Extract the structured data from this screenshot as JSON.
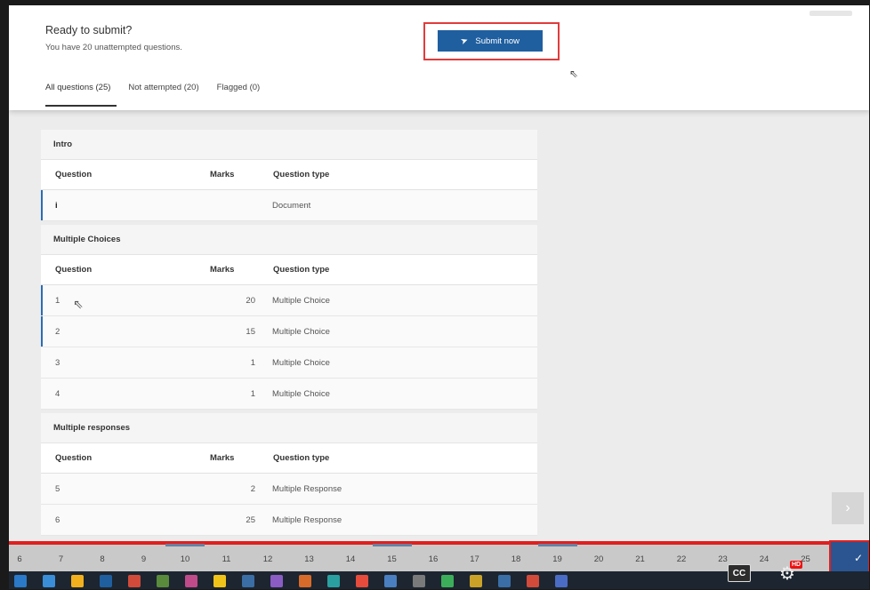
{
  "header": {
    "title": "Ready to submit?",
    "subtitle": "You have 20 unattempted questions.",
    "submit_label": "Submit now"
  },
  "tabs": [
    {
      "label": "All questions (25)",
      "active": true
    },
    {
      "label": "Not attempted (20)",
      "active": false
    },
    {
      "label": "Flagged (0)",
      "active": false
    }
  ],
  "columns": {
    "question": "Question",
    "marks": "Marks",
    "type": "Question type"
  },
  "sections": [
    {
      "name": "Intro",
      "rows": [
        {
          "question": "i",
          "marks": "",
          "type": "Document",
          "attempted": true
        }
      ]
    },
    {
      "name": "Multiple Choices",
      "rows": [
        {
          "question": "1",
          "marks": "20",
          "type": "Multiple Choice",
          "attempted": true
        },
        {
          "question": "2",
          "marks": "15",
          "type": "Multiple Choice",
          "attempted": true
        },
        {
          "question": "3",
          "marks": "1",
          "type": "Multiple Choice",
          "attempted": false
        },
        {
          "question": "4",
          "marks": "1",
          "type": "Multiple Choice",
          "attempted": false
        }
      ]
    },
    {
      "name": "Multiple responses",
      "rows": [
        {
          "question": "5",
          "marks": "2",
          "type": "Multiple Response",
          "attempted": false
        },
        {
          "question": "6",
          "marks": "25",
          "type": "Multiple Response",
          "attempted": false
        }
      ]
    }
  ],
  "nav": {
    "numbers": [
      "6",
      "7",
      "8",
      "9",
      "10",
      "11",
      "12",
      "13",
      "14",
      "15",
      "16",
      "17",
      "18",
      "19",
      "20",
      "21",
      "22",
      "23",
      "24",
      "25"
    ],
    "marked": [
      "10",
      "15",
      "19"
    ]
  },
  "player": {
    "cc_label": "CC",
    "hd_label": "HD"
  },
  "colors": {
    "accent": "#1f5fa0",
    "highlight": "#e01f1f",
    "attempted_bar": "#2b6cb0"
  }
}
